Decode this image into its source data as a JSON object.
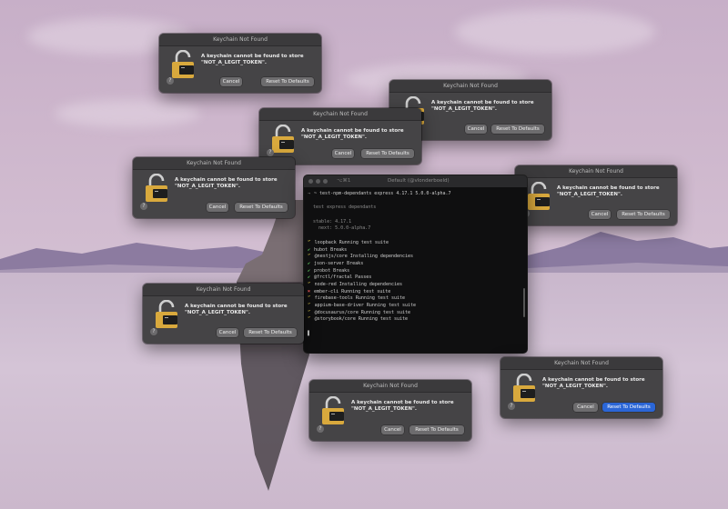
{
  "dialog": {
    "title": "Keychain Not Found",
    "message_line1": "A keychain cannot be found to store",
    "message_line2": "\"NOT_A_LEGIT_TOKEN\".",
    "help_label": "?",
    "cancel_label": "Cancel",
    "reset_label": "Reset To Defaults"
  },
  "terminal": {
    "tab_label": "⌥⌘1",
    "title": "Default (@vlonderboeld)",
    "lines": [
      {
        "icon": "→",
        "icon_class": "t-dim",
        "text": "~ test-npm-dependants express 4.17.1 5.0.0-alpha.7",
        "text_class": ""
      },
      {
        "icon": "",
        "icon_class": "",
        "text": "",
        "text_class": ""
      },
      {
        "icon": "",
        "icon_class": "",
        "text": "  test express dependants",
        "text_class": "t-dim"
      },
      {
        "icon": "",
        "icon_class": "",
        "text": "",
        "text_class": ""
      },
      {
        "icon": "",
        "icon_class": "",
        "text": "  stable: 4.17.1",
        "text_class": "t-dim"
      },
      {
        "icon": "",
        "icon_class": "",
        "text": "    next: 5.0.0-alpha.7",
        "text_class": "t-dim"
      },
      {
        "icon": "",
        "icon_class": "",
        "text": "",
        "text_class": ""
      },
      {
        "icon": "⠋",
        "icon_class": "t-spin",
        "text": "loopback Running test suite",
        "text_class": ""
      },
      {
        "icon": "✔",
        "icon_class": "t-check",
        "text": "hubot Breaks",
        "text_class": ""
      },
      {
        "icon": "⠋",
        "icon_class": "t-spin",
        "text": "@nestjs/core Installing dependencies",
        "text_class": ""
      },
      {
        "icon": "✔",
        "icon_class": "t-check",
        "text": "json-server Breaks",
        "text_class": ""
      },
      {
        "icon": "✔",
        "icon_class": "t-check",
        "text": "probot Breaks",
        "text_class": ""
      },
      {
        "icon": "✔",
        "icon_class": "t-check",
        "text": "@frctl/fractal Passes",
        "text_class": ""
      },
      {
        "icon": "⠋",
        "icon_class": "t-spin",
        "text": "node-red Installing dependencies",
        "text_class": ""
      },
      {
        "icon": "✖",
        "icon_class": "t-cross",
        "text": "ember-cli Running test suite",
        "text_class": ""
      },
      {
        "icon": "⠋",
        "icon_class": "t-spin",
        "text": "firebase-tools Running test suite",
        "text_class": ""
      },
      {
        "icon": "⠋",
        "icon_class": "t-spin",
        "text": "appium-base-driver Running test suite",
        "text_class": ""
      },
      {
        "icon": "⠋",
        "icon_class": "t-spin",
        "text": "@docusaurus/core Running test suite",
        "text_class": ""
      },
      {
        "icon": "⠋",
        "icon_class": "t-spin",
        "text": "@storybook/core Running test suite",
        "text_class": ""
      },
      {
        "icon": "",
        "icon_class": "",
        "text": "",
        "text_class": ""
      },
      {
        "icon": "▋",
        "icon_class": "",
        "text": "",
        "text_class": ""
      }
    ]
  },
  "colors": {
    "dialog_bg": "#454446",
    "primary_button": "#2b66d6",
    "lock_gold": "#d9a93d"
  }
}
